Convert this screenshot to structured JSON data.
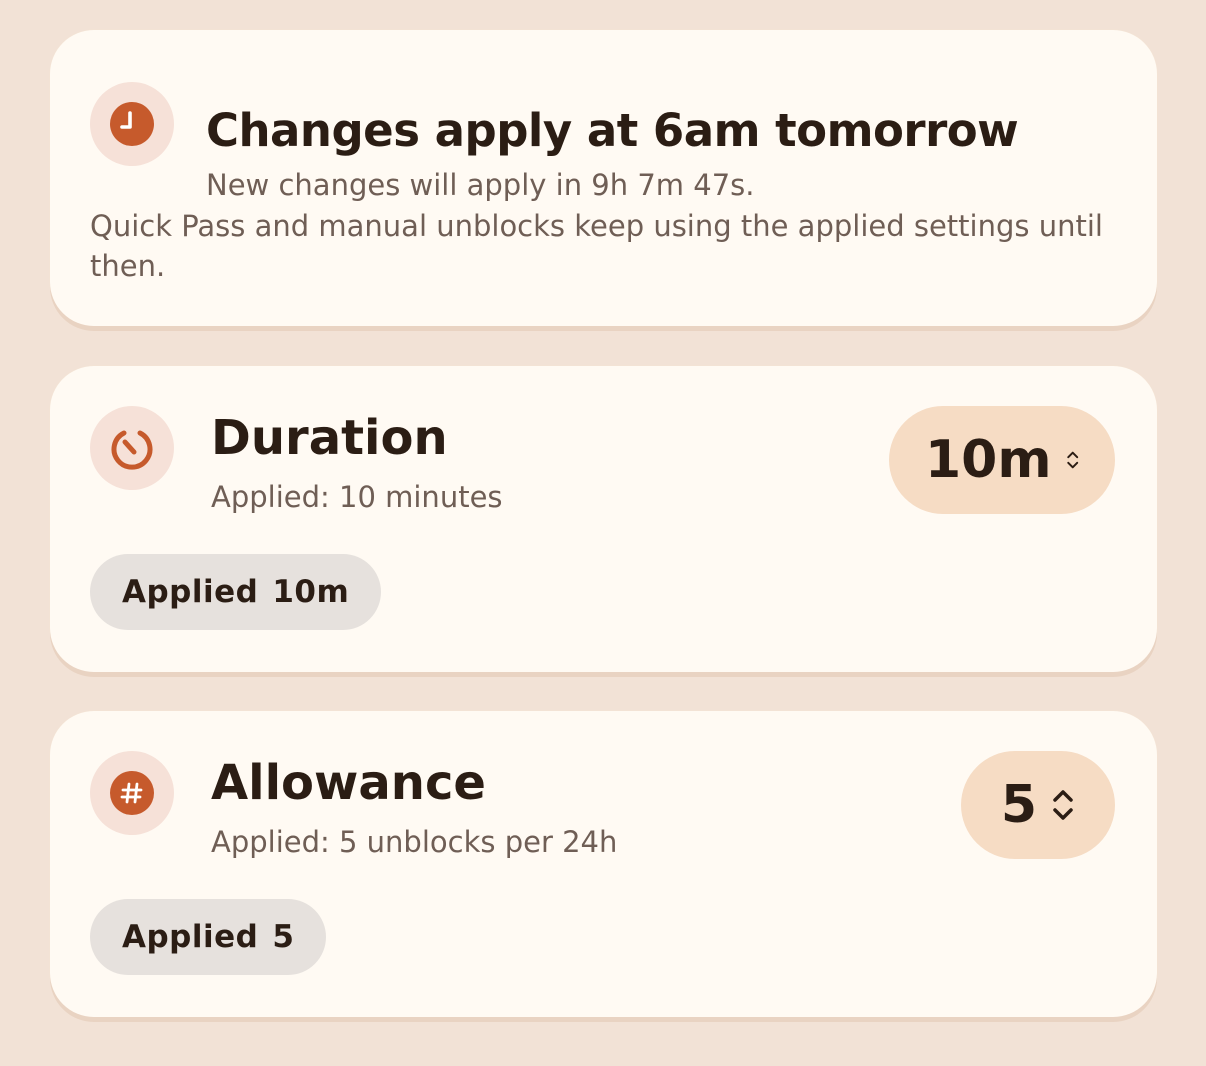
{
  "notice": {
    "title": "Changes apply at 6am tomorrow",
    "subtitle": "New changes will apply in 9h 7m 47s.",
    "body": "Quick Pass and manual unblocks keep using the applied settings until then.",
    "icon": "clock-icon"
  },
  "settings": [
    {
      "title": "Duration",
      "subtitle": "Applied: 10 minutes",
      "stepper_value": "10m",
      "chip_label": "Applied",
      "chip_value": "10m",
      "icon": "timer-icon"
    },
    {
      "title": "Allowance",
      "subtitle": "Applied: 5 unblocks per 24h",
      "stepper_value": "5",
      "chip_label": "Applied",
      "chip_value": "5",
      "icon": "hash-icon"
    }
  ],
  "colors": {
    "background": "#f2e2d6",
    "card": "#fffaf3",
    "accent": "#c65a2c",
    "icon_bg": "#f6e1d8",
    "stepper_bg": "#f6dcc4",
    "chip_bg": "#e6e1dd"
  }
}
